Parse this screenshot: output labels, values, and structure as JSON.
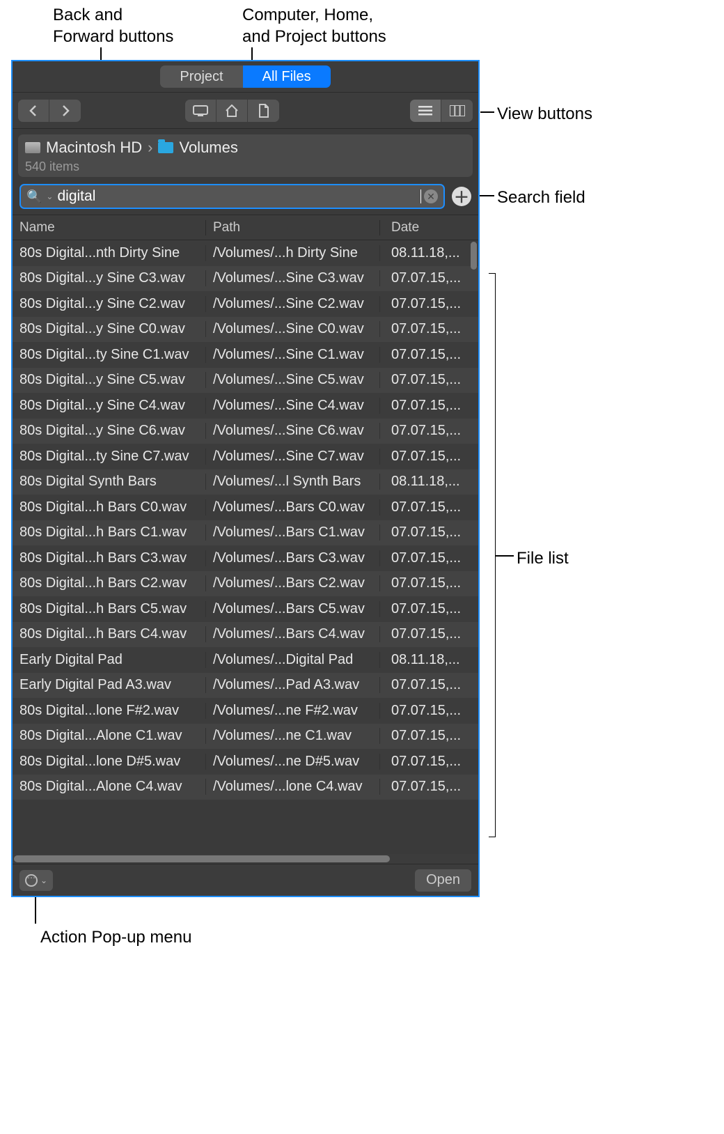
{
  "callouts": {
    "back_forward": "Back and\nForward buttons",
    "chp": "Computer, Home,\nand Project buttons",
    "view": "View buttons",
    "search": "Search field",
    "filelist": "File list",
    "action": "Action Pop-up menu"
  },
  "tabs": {
    "project": "Project",
    "allfiles": "All Files"
  },
  "breadcrumb": {
    "root": "Macintosh HD",
    "folder": "Volumes"
  },
  "item_count": "540 items",
  "search": {
    "value": "digital"
  },
  "columns": {
    "name": "Name",
    "path": "Path",
    "date": "Date"
  },
  "open_label": "Open",
  "rows": [
    {
      "name": "80s Digital...nth Dirty Sine",
      "path": "/Volumes/...h Dirty Sine",
      "date": "08.11.18,..."
    },
    {
      "name": "80s Digital...y Sine C3.wav",
      "path": "/Volumes/...Sine C3.wav",
      "date": "07.07.15,..."
    },
    {
      "name": "80s Digital...y Sine C2.wav",
      "path": "/Volumes/...Sine C2.wav",
      "date": "07.07.15,..."
    },
    {
      "name": "80s Digital...y Sine C0.wav",
      "path": "/Volumes/...Sine C0.wav",
      "date": "07.07.15,..."
    },
    {
      "name": "80s Digital...ty Sine C1.wav",
      "path": "/Volumes/...Sine C1.wav",
      "date": "07.07.15,..."
    },
    {
      "name": "80s Digital...y Sine C5.wav",
      "path": "/Volumes/...Sine C5.wav",
      "date": "07.07.15,..."
    },
    {
      "name": "80s Digital...y Sine C4.wav",
      "path": "/Volumes/...Sine C4.wav",
      "date": "07.07.15,..."
    },
    {
      "name": "80s Digital...y Sine C6.wav",
      "path": "/Volumes/...Sine C6.wav",
      "date": "07.07.15,..."
    },
    {
      "name": "80s Digital...ty Sine C7.wav",
      "path": "/Volumes/...Sine C7.wav",
      "date": "07.07.15,..."
    },
    {
      "name": "80s Digital Synth Bars",
      "path": "/Volumes/...l Synth Bars",
      "date": "08.11.18,..."
    },
    {
      "name": "80s Digital...h Bars C0.wav",
      "path": "/Volumes/...Bars C0.wav",
      "date": "07.07.15,..."
    },
    {
      "name": "80s Digital...h Bars C1.wav",
      "path": "/Volumes/...Bars C1.wav",
      "date": "07.07.15,..."
    },
    {
      "name": "80s Digital...h Bars C3.wav",
      "path": "/Volumes/...Bars C3.wav",
      "date": "07.07.15,..."
    },
    {
      "name": "80s Digital...h Bars C2.wav",
      "path": "/Volumes/...Bars C2.wav",
      "date": "07.07.15,..."
    },
    {
      "name": "80s Digital...h Bars C5.wav",
      "path": "/Volumes/...Bars C5.wav",
      "date": "07.07.15,..."
    },
    {
      "name": "80s Digital...h Bars C4.wav",
      "path": "/Volumes/...Bars C4.wav",
      "date": "07.07.15,..."
    },
    {
      "name": "Early Digital Pad",
      "path": "/Volumes/...Digital Pad",
      "date": "08.11.18,..."
    },
    {
      "name": "Early Digital Pad A3.wav",
      "path": "/Volumes/...Pad A3.wav",
      "date": "07.07.15,..."
    },
    {
      "name": "80s Digital...lone F#2.wav",
      "path": "/Volumes/...ne F#2.wav",
      "date": "07.07.15,..."
    },
    {
      "name": "80s Digital...Alone C1.wav",
      "path": "/Volumes/...ne C1.wav",
      "date": "07.07.15,..."
    },
    {
      "name": "80s Digital...lone D#5.wav",
      "path": "/Volumes/...ne D#5.wav",
      "date": "07.07.15,..."
    },
    {
      "name": "80s Digital...Alone C4.wav",
      "path": "/Volumes/...lone C4.wav",
      "date": "07.07.15,..."
    }
  ]
}
